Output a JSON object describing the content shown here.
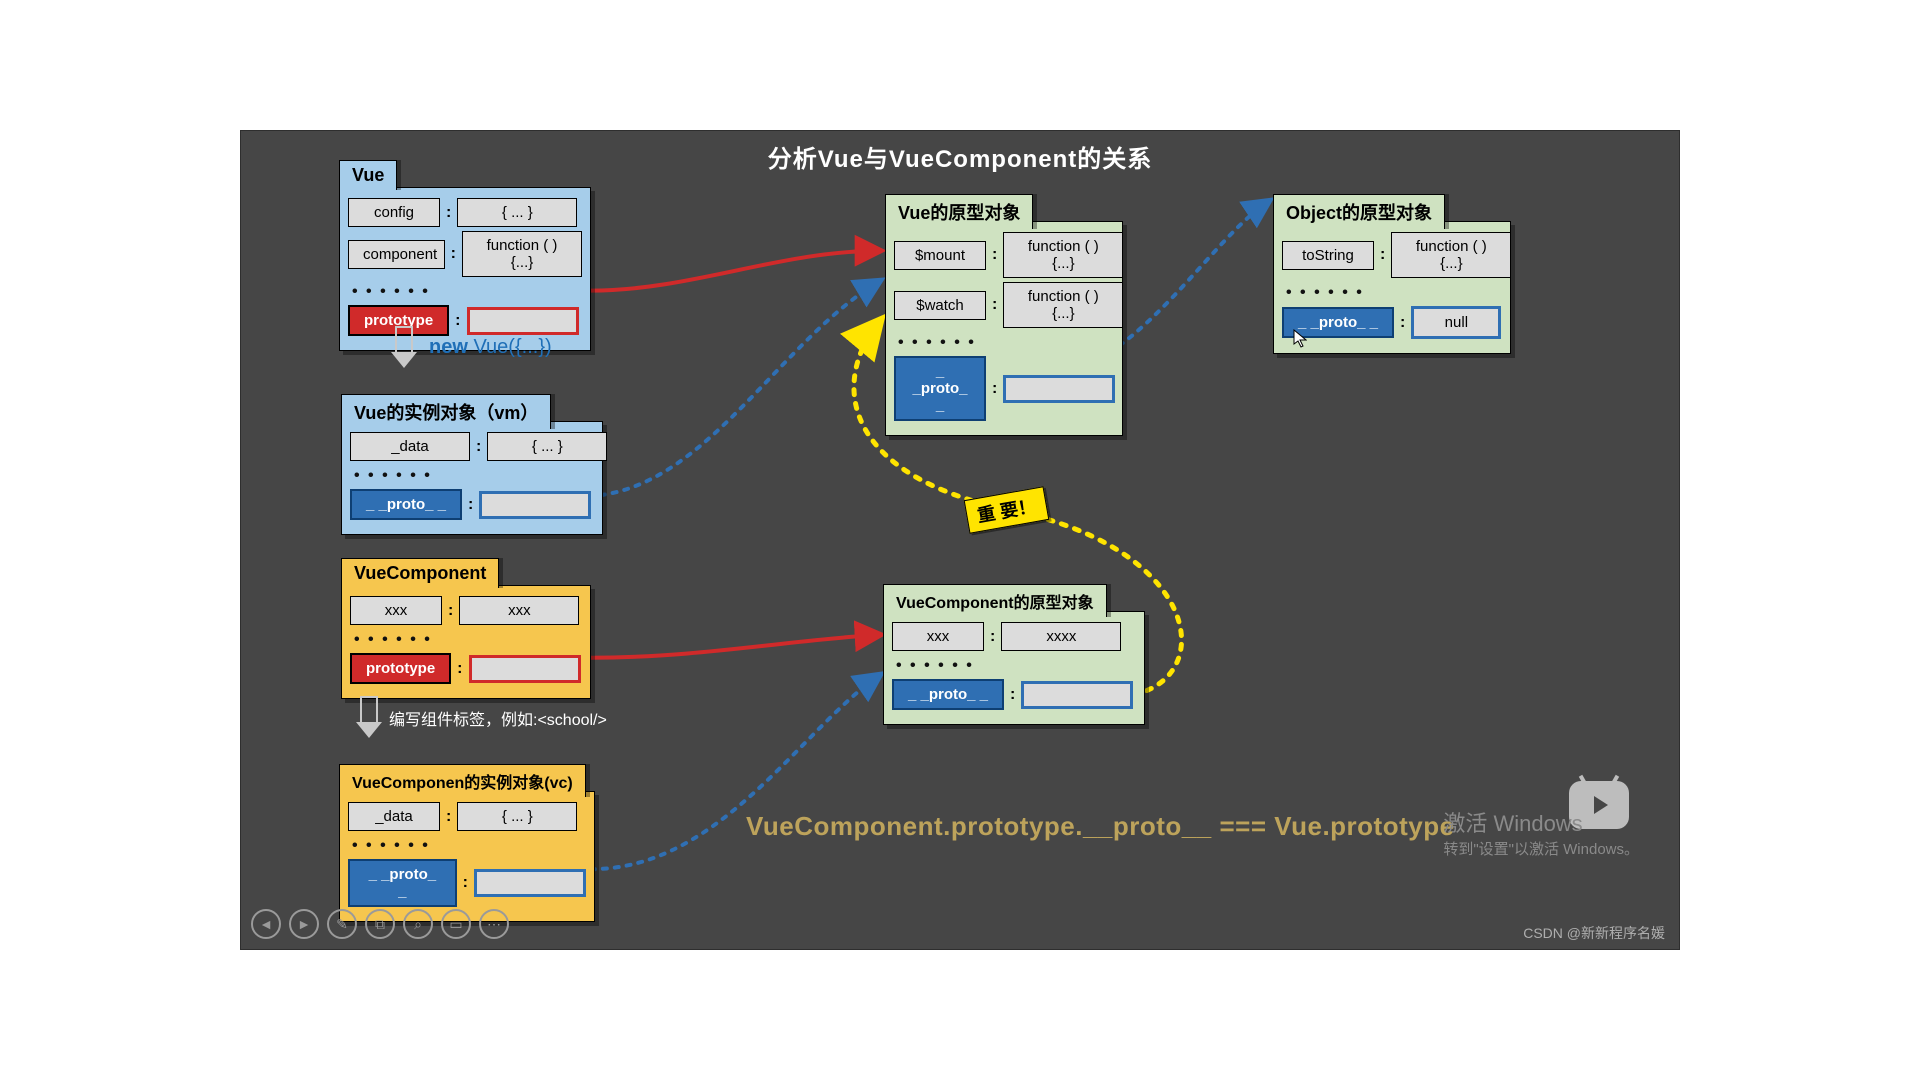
{
  "title": "分析Vue与VueComponent的关系",
  "vue": {
    "tab": "Vue",
    "rows": [
      [
        "config",
        "{ ... }"
      ],
      [
        "component",
        "function ( ) {...}"
      ]
    ],
    "dots": "• • • • • •",
    "proto_label": "prototype"
  },
  "new_vue_hint": {
    "kw": "new",
    "rest": " Vue({...})"
  },
  "vm": {
    "tab": "Vue的实例对象（vm）",
    "rows": [
      [
        "_data",
        "{ ... }"
      ]
    ],
    "dots": "• • • • • •",
    "proto_label": "_ _proto_ _"
  },
  "vue_proto": {
    "tab": "Vue的原型对象",
    "rows": [
      [
        "$mount",
        "function ( ) {...}"
      ],
      [
        "$watch",
        "function ( ) {...}"
      ]
    ],
    "dots": "• • • • • •",
    "proto_label": "_ _proto_ _"
  },
  "obj_proto": {
    "tab": "Object的原型对象",
    "rows": [
      [
        "toString",
        "function ( ) {...}"
      ]
    ],
    "dots": "• • • • • •",
    "proto_label": "_ _proto_ _",
    "proto_val": "null"
  },
  "vc_ctor": {
    "tab": "VueComponent",
    "rows": [
      [
        "xxx",
        "xxx"
      ]
    ],
    "dots": "• • • • • •",
    "proto_label": "prototype"
  },
  "write_tag_hint": "编写组件标签，例如:<school/>",
  "vc_inst": {
    "tab": "VueComponen的实例对象(vc)",
    "rows": [
      [
        "_data",
        "{ ... }"
      ]
    ],
    "dots": "• • • • • •",
    "proto_label": "_ _proto_ _"
  },
  "vc_proto": {
    "tab": "VueComponent的原型对象",
    "rows": [
      [
        "xxx",
        "xxxx"
      ]
    ],
    "dots": "• • • • • •",
    "proto_label": "_ _proto_ _"
  },
  "important_badge": "重 要！",
  "code_line": "VueComponent.prototype.__proto__  ===  Vue.prototype",
  "watermark_line1": "激活 Windows",
  "watermark_line2": "转到\"设置\"以激活 Windows。",
  "csdn": "CSDN @新新程序名媛",
  "toolbar_icons": [
    "◄",
    "►",
    "✎",
    "⧉",
    "⌕",
    "▭",
    "⋯"
  ]
}
